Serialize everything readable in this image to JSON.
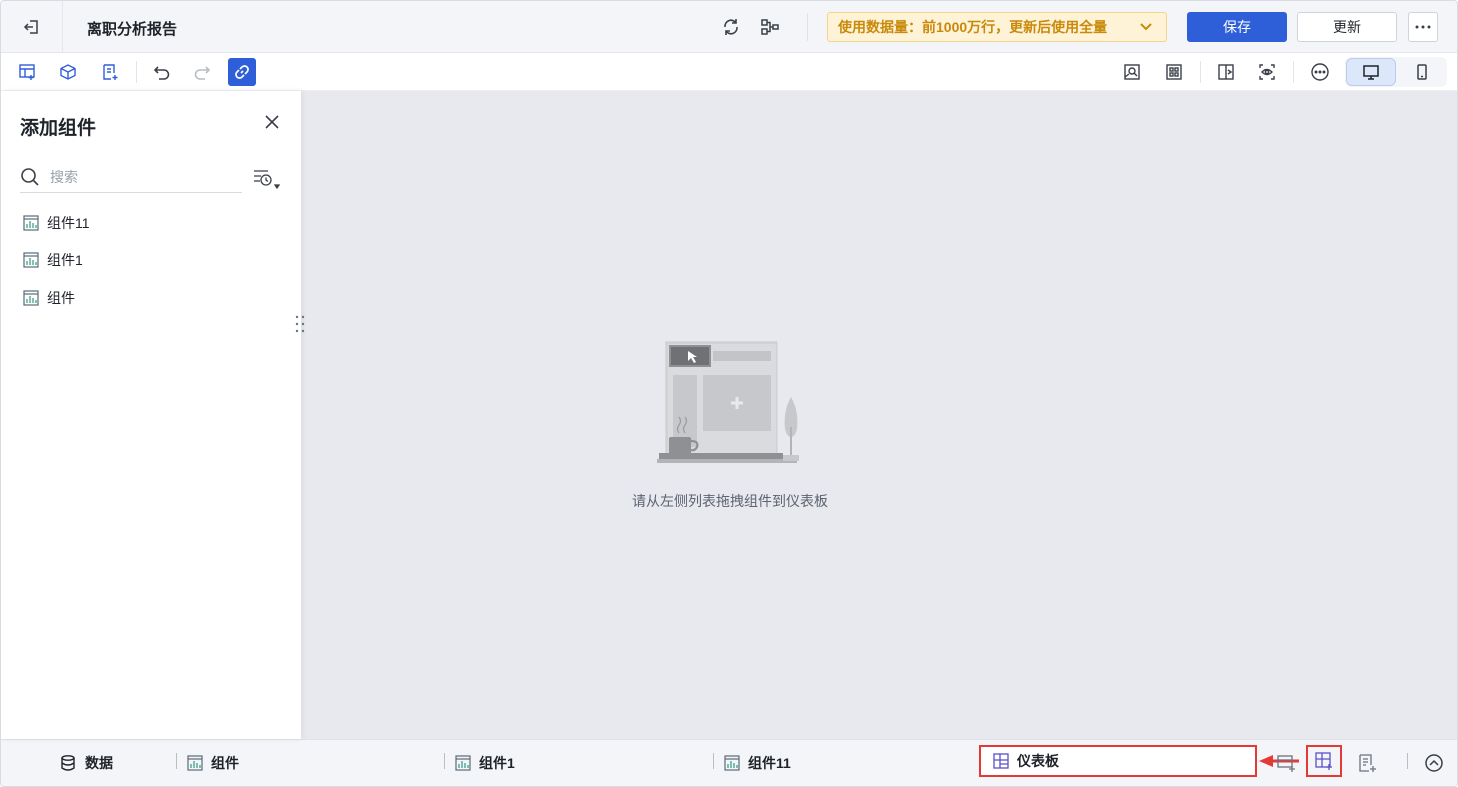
{
  "header": {
    "title": "离职分析报告",
    "usage_notice": "使用数据量：前1000万行，更新后使用全量",
    "save_label": "保存",
    "update_label": "更新"
  },
  "sidebar": {
    "title": "添加组件",
    "search_placeholder": "搜索",
    "items": [
      {
        "label": "组件11"
      },
      {
        "label": "组件1"
      },
      {
        "label": "组件"
      }
    ]
  },
  "canvas": {
    "empty_text": "请从左侧列表拖拽组件到仪表板"
  },
  "bottom_tabs": {
    "data_label": "数据",
    "tabs": [
      {
        "label": "组件"
      },
      {
        "label": "组件1"
      },
      {
        "label": "组件11"
      }
    ],
    "active_label": "仪表板"
  },
  "colors": {
    "primary": "#2f5fd8",
    "warning_bg": "#fef3d7",
    "warning_text": "#c98a0b",
    "annotation_red": "#e53935",
    "canvas_bg": "#e8e9ee"
  }
}
